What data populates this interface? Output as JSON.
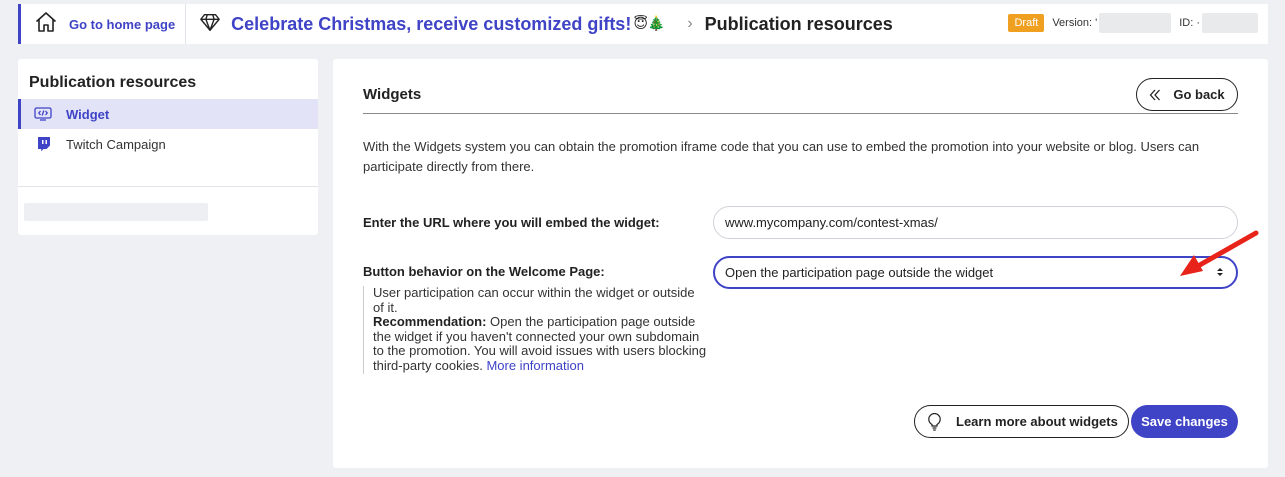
{
  "header": {
    "home_label": "Go to home page",
    "campaign_title": "Celebrate Christmas, receive customized gifts!",
    "campaign_emojis": "😇🎄",
    "breadcrumb_separator": "›",
    "current_section": "Publication resources",
    "status_badge": "Draft",
    "version_label": "Version: '",
    "id_label": "ID: ·"
  },
  "sidebar": {
    "title": "Publication resources",
    "items": [
      {
        "label": "Widget",
        "icon": "widget-code-icon",
        "active": true
      },
      {
        "label": "Twitch Campaign",
        "icon": "twitch-icon",
        "active": false
      }
    ]
  },
  "main": {
    "title": "Widgets",
    "go_back_label": "Go back",
    "intro": "With the Widgets system you can obtain the promotion iframe code that you can use to embed the promotion into your website or blog. Users can participate directly from there.",
    "url_field": {
      "label": "Enter the URL where you will embed the widget:",
      "value": "www.mycompany.com/contest-xmas/"
    },
    "button_behavior": {
      "label": "Button behavior on the Welcome Page:",
      "selected": "Open the participation page outside the widget"
    },
    "help": {
      "text": "User participation can occur within the widget or outside of it.",
      "recommendation_label": "Recommendation:",
      "recommendation_text": "Open the participation page outside the widget if you haven't connected your own subdomain to the promotion. You will avoid issues with users blocking third-party cookies.",
      "link": "More information"
    },
    "learn_more_label": "Learn more about widgets",
    "save_label": "Save changes"
  },
  "colors": {
    "accent": "#3f43c6",
    "draft_badge": "#f0a020",
    "annotation_arrow": "#e8231a",
    "background": "#eef0f3"
  }
}
